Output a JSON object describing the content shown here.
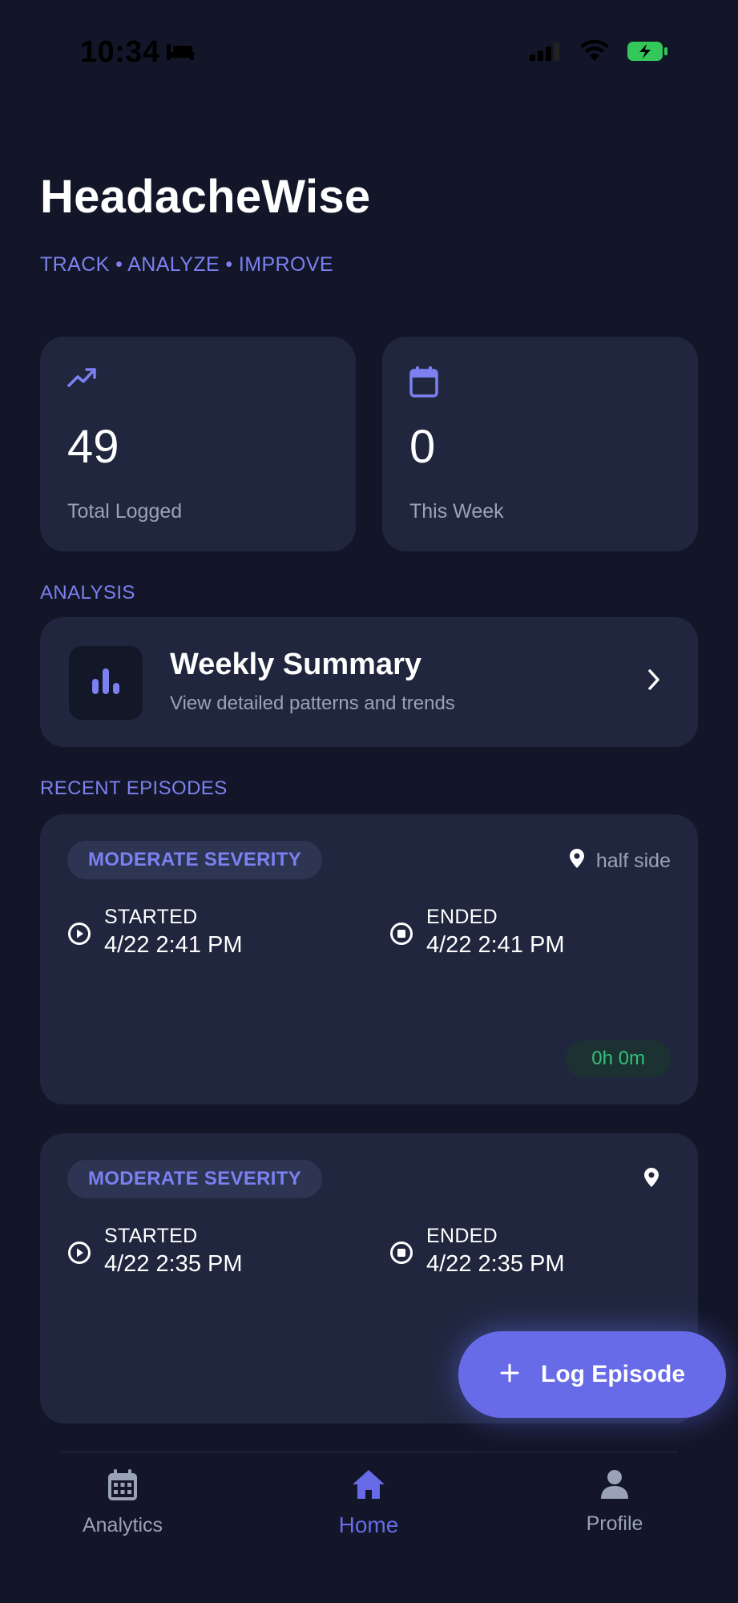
{
  "status_bar": {
    "time": "10:34"
  },
  "header": {
    "title": "HeadacheWise",
    "tagline": "TRACK • ANALYZE • IMPROVE"
  },
  "stats": [
    {
      "icon": "trending-up-icon",
      "value": "49",
      "label": "Total Logged"
    },
    {
      "icon": "calendar-icon",
      "value": "0",
      "label": "This Week"
    }
  ],
  "analysis": {
    "section_label": "ANALYSIS",
    "card": {
      "icon": "bar-chart-icon",
      "title": "Weekly Summary",
      "subtitle": "View detailed patterns and trends"
    }
  },
  "recent": {
    "section_label": "RECENT EPISODES",
    "episodes": [
      {
        "severity": "MODERATE SEVERITY",
        "location": "half side",
        "started_label": "STARTED",
        "started": "4/22 2:41 PM",
        "ended_label": "ENDED",
        "ended": "4/22 2:41 PM",
        "duration": "0h 0m"
      },
      {
        "severity": "MODERATE SEVERITY",
        "location": "",
        "started_label": "STARTED",
        "started": "4/22 2:35 PM",
        "ended_label": "ENDED",
        "ended": "4/22 2:35 PM"
      }
    ]
  },
  "fab": {
    "label": "Log Episode"
  },
  "tabs": [
    {
      "label": "Analytics",
      "icon": "calendar-icon",
      "active": false
    },
    {
      "label": "Home",
      "icon": "home-icon",
      "active": true
    },
    {
      "label": "Profile",
      "icon": "person-icon",
      "active": false
    }
  ],
  "colors": {
    "background": "#121628",
    "card": "#1f263d",
    "accent": "#676be8",
    "accent_text": "#7c80f0",
    "muted_text": "#9aa2b8",
    "duration_green": "#34c07a"
  }
}
